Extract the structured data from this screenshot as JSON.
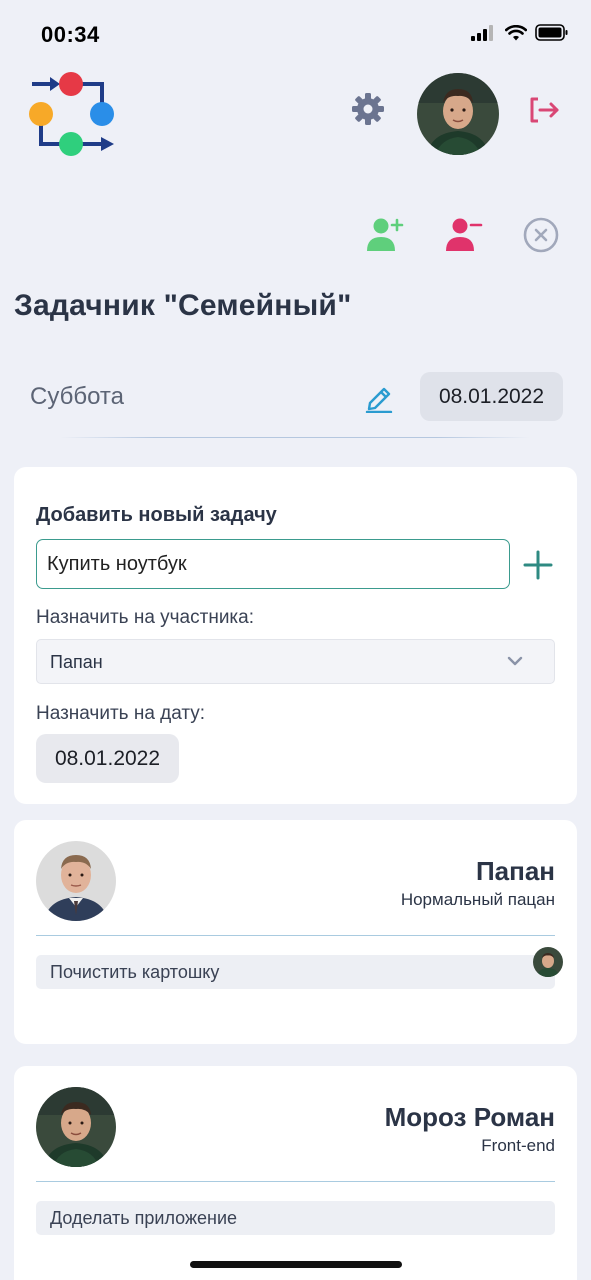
{
  "status_bar": {
    "time": "00:34"
  },
  "header": {
    "logo_icon": "process-flow-logo-icon",
    "settings_icon": "gear-icon",
    "logout_icon": "logout-icon"
  },
  "actions": {
    "add_member_icon": "add-user-icon",
    "remove_member_icon": "remove-user-icon",
    "close_icon": "close-circle-icon"
  },
  "page": {
    "title": "Задачник \"Семейный\"",
    "day_name": "Суббота",
    "current_date": "08.01.2022"
  },
  "add_task": {
    "title": "Добавить новый задачу",
    "input_value": "Купить ноутбук",
    "assign_member_label": "Назначить на участника:",
    "selected_member": "Папан",
    "assign_date_label": "Назначить на дату:",
    "selected_date": "08.01.2022"
  },
  "members": [
    {
      "name": "Папан",
      "role": "Нормальный пацан",
      "tasks": [
        "Почистить картошку"
      ]
    },
    {
      "name": "Мороз Роман",
      "role": "Front-end",
      "tasks": [
        "Доделать приложение"
      ]
    }
  ],
  "colors": {
    "background": "#eef0f7",
    "accent_teal": "#2e8a82",
    "add_user_green": "#5fcf7c",
    "remove_user_pink": "#e0336b",
    "logout_pink": "#d94775",
    "text_dark": "#2b3446"
  }
}
